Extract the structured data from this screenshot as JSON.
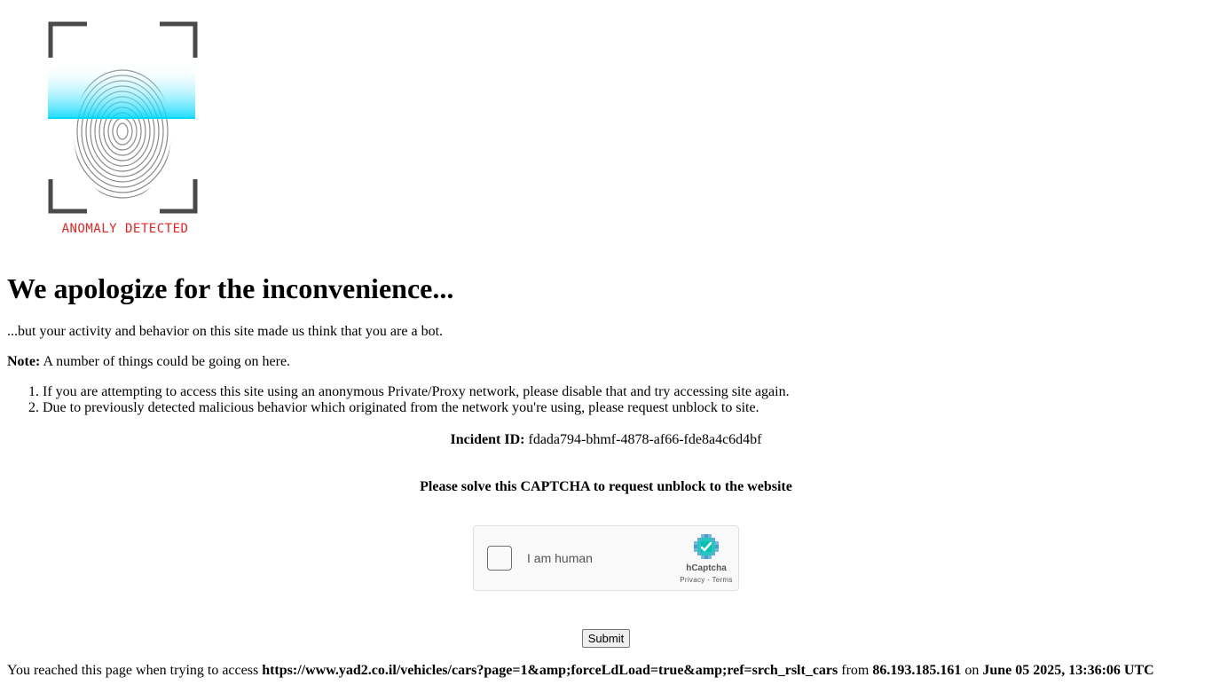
{
  "logo": {
    "icon": "fingerprint-scan-icon",
    "text": "ANOMALY DETECTED",
    "text_color": "#e82525",
    "scan_color": "#00d8ff"
  },
  "heading": "We apologize for the inconvenience...",
  "intro": "...but your activity and behavior on this site made us think that you are a bot.",
  "note": {
    "label": "Note:",
    "text": "A number of things could be going on here."
  },
  "reasons": [
    "If you are attempting to access this site using an anonymous Private/Proxy network, please disable that and try accessing site again.",
    "Due to previously detected malicious behavior which originated from the network you're using, please request unblock to site."
  ],
  "incident": {
    "label": "Incident ID:",
    "value": "fdada794-bhmf-4878-af66-fde8a4c6d4bf"
  },
  "captcha_prompt": "Please solve this CAPTCHA to request unblock to the website",
  "captcha": {
    "checkbox_label": "I am human",
    "brand": "hCaptcha",
    "privacy": "Privacy",
    "separator": "-",
    "terms": "Terms"
  },
  "submit_label": "Submit",
  "footer": {
    "prefix": "You reached this page when trying to access",
    "url": "https://www.yad2.co.il/vehicles/cars?page=1&amp;forceLdLoad=true&amp;ref=srch_rslt_cars",
    "from_text": "from",
    "ip": "86.193.185.161",
    "on_text": "on",
    "datetime": "June 05 2025, 13:36:06 UTC"
  }
}
